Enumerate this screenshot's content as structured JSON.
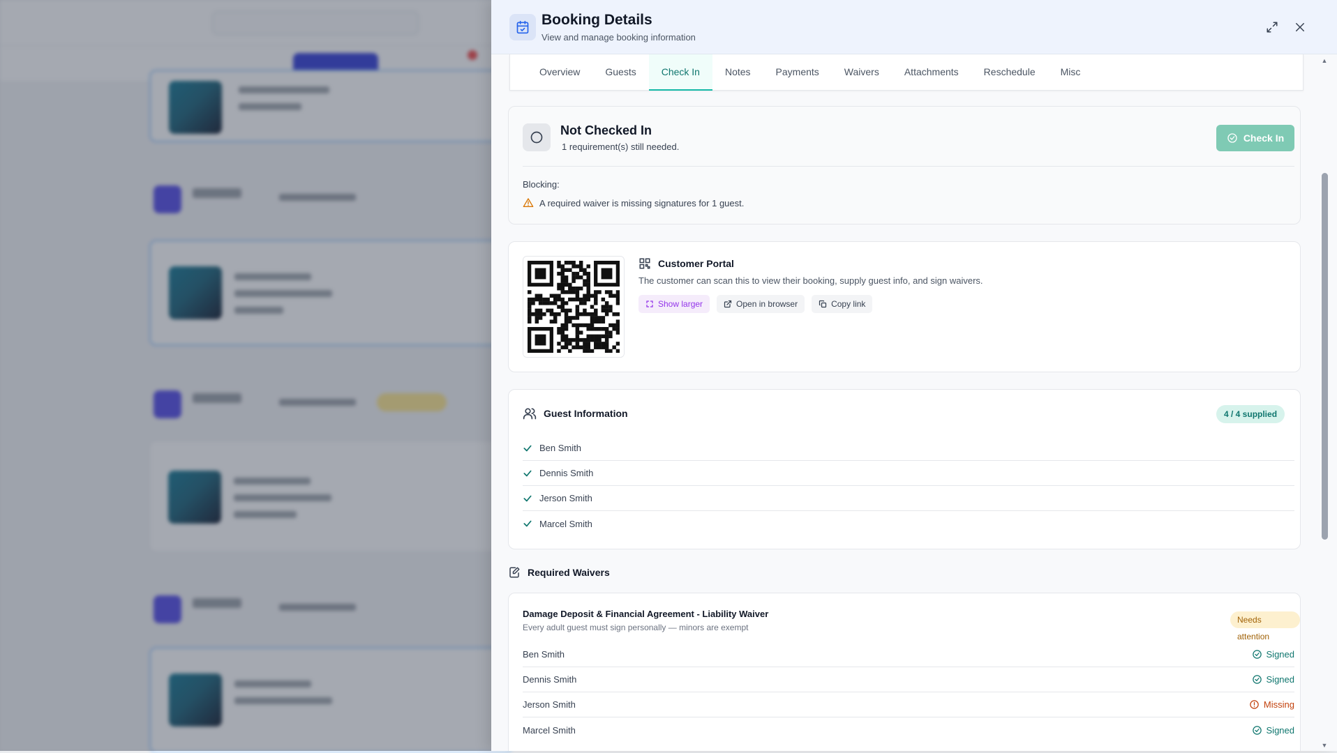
{
  "drawer": {
    "title": "Booking Details",
    "subtitle": "View and manage booking information"
  },
  "tabs": [
    {
      "label": "Overview",
      "active": false
    },
    {
      "label": "Guests",
      "active": false
    },
    {
      "label": "Check In",
      "active": true
    },
    {
      "label": "Notes",
      "active": false
    },
    {
      "label": "Payments",
      "active": false
    },
    {
      "label": "Waivers",
      "active": false
    },
    {
      "label": "Attachments",
      "active": false
    },
    {
      "label": "Reschedule",
      "active": false
    },
    {
      "label": "Misc",
      "active": false
    }
  ],
  "checkin": {
    "status": "Not Checked In",
    "requirements": "1 requirement(s) still needed.",
    "button_label": "Check In",
    "blocking_label": "Blocking:",
    "blocking_item": "A required waiver is missing signatures for 1 guest."
  },
  "portal": {
    "title": "Customer Portal",
    "description": "The customer can scan this to view their booking, supply guest info, and sign waivers.",
    "show_larger": "Show larger",
    "open_browser": "Open in browser",
    "copy_link": "Copy link"
  },
  "guests": {
    "title": "Guest Information",
    "badge": "4 / 4 supplied",
    "list": [
      "Ben Smith",
      "Dennis Smith",
      "Jerson Smith",
      "Marcel Smith"
    ]
  },
  "waivers": {
    "section_title": "Required Waivers",
    "name": "Damage Deposit & Financial Agreement - Liability Waiver",
    "rule": "Every adult guest must sign personally — minors are exempt",
    "badge": "Needs attention",
    "rows": [
      {
        "name": "Ben Smith",
        "status": "Signed"
      },
      {
        "name": "Dennis Smith",
        "status": "Signed"
      },
      {
        "name": "Jerson Smith",
        "status": "Missing"
      },
      {
        "name": "Marcel Smith",
        "status": "Signed"
      }
    ]
  },
  "colors": {
    "accent": "#14b8a6",
    "checkin_button": "#7fcab4",
    "signed": "#0f766e",
    "missing": "#c2410c",
    "warning": "#d97706"
  }
}
